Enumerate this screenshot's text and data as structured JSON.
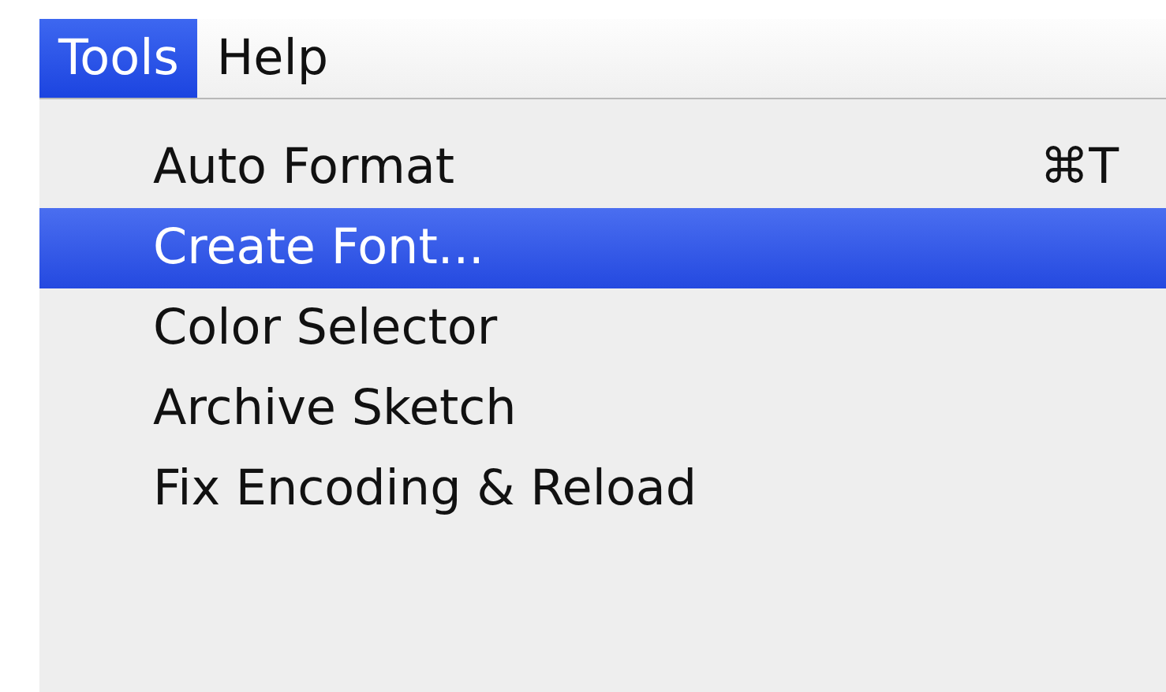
{
  "menu_bar": [
    {
      "label": "Tools",
      "selected": true
    },
    {
      "label": "Help",
      "selected": false
    }
  ],
  "menu": [
    {
      "label": "Auto Format",
      "shortcut": "⌘T",
      "selected": false
    },
    {
      "label": "Create Font...",
      "selected": true
    },
    {
      "label": "Color Selector",
      "selected": false
    },
    {
      "label": "Archive Sketch",
      "selected": false
    },
    {
      "label": "Fix Encoding & Reload",
      "selected": false
    }
  ]
}
